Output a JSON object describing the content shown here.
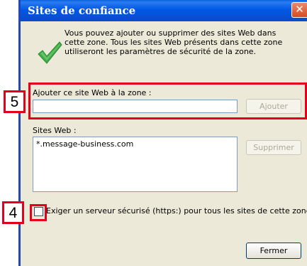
{
  "dialog": {
    "title": "Sites de confiance",
    "close_glyph": "✕",
    "info_icon": "green-checkmark-icon",
    "info_text": "Vous pouvez ajouter ou supprimer des sites Web dans cette zone. Tous les sites Web présents dans cette zone utiliseront les paramètres de sécurité de la zone.",
    "add_label": "Ajouter ce site Web à la zone :",
    "add_input_value": "",
    "add_button": "Ajouter",
    "sites_label": "Sites Web :",
    "sites": [
      "*.message-business.com"
    ],
    "remove_button": "Supprimer",
    "https_checkbox_label": "Exiger un serveur sécurisé (https:) pour tous les sites de cette zone",
    "https_checked": false,
    "close_button": "Fermer"
  },
  "annotations": {
    "badge_5": "5",
    "badge_4": "4",
    "highlight_color": "#e3001b"
  },
  "colors": {
    "titlebar": "#0058e6",
    "dialog_bg": "#ece9d8",
    "check_green": "#2ea44f"
  }
}
